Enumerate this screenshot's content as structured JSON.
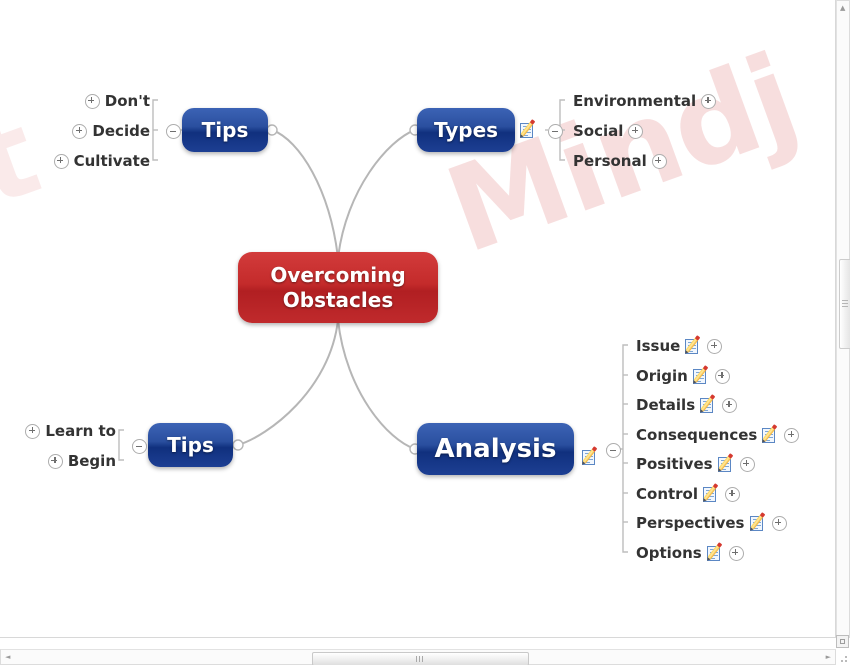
{
  "document": {
    "watermark_text": "Mindj",
    "watermark_text_left": "et"
  },
  "mindmap": {
    "root": {
      "label": "Overcoming Obstacles",
      "label_line1": "Overcoming",
      "label_line2": "Obstacles",
      "color": "#c42b2b"
    },
    "branches": [
      {
        "id": "tips-top",
        "label": "Tips",
        "color": "#1d3f93",
        "position": "top-left",
        "collapse_state": "minus",
        "has_note": false,
        "children": [
          {
            "label": "Don't",
            "toggle": "plus",
            "has_note": false
          },
          {
            "label": "Decide",
            "toggle": "plus",
            "has_note": false
          },
          {
            "label": "Cultivate",
            "toggle": "plus",
            "has_note": false
          }
        ]
      },
      {
        "id": "types",
        "label": "Types",
        "color": "#1d3f93",
        "position": "top-right",
        "collapse_state": "minus",
        "has_note": true,
        "children": [
          {
            "label": "Environmental",
            "toggle": "plus",
            "has_note": false
          },
          {
            "label": "Social",
            "toggle": "plus",
            "has_note": false
          },
          {
            "label": "Personal",
            "toggle": "plus",
            "has_note": false
          }
        ]
      },
      {
        "id": "tips-bottom",
        "label": "Tips",
        "color": "#1d3f93",
        "position": "bottom-left",
        "collapse_state": "minus",
        "has_note": false,
        "children": [
          {
            "label": "Learn to",
            "toggle": "plus",
            "has_note": false
          },
          {
            "label": "Begin",
            "toggle": "plus",
            "has_note": false
          }
        ]
      },
      {
        "id": "analysis",
        "label": "Analysis",
        "color": "#1d3f93",
        "position": "bottom-right",
        "collapse_state": "minus",
        "has_note": true,
        "children": [
          {
            "label": "Issue",
            "toggle": "plus",
            "has_note": true
          },
          {
            "label": "Origin",
            "toggle": "plus",
            "has_note": true
          },
          {
            "label": "Details",
            "toggle": "plus",
            "has_note": true
          },
          {
            "label": "Consequences",
            "toggle": "plus",
            "has_note": true
          },
          {
            "label": "Positives",
            "toggle": "plus",
            "has_note": true
          },
          {
            "label": "Control",
            "toggle": "plus",
            "has_note": true
          },
          {
            "label": "Perspectives",
            "toggle": "plus",
            "has_note": true
          },
          {
            "label": "Options",
            "toggle": "plus",
            "has_note": true
          }
        ]
      }
    ]
  },
  "scrollbars": {
    "vertical": {
      "up_arrow": "▲",
      "down_arrow": "▼"
    },
    "horizontal": {
      "left_arrow": "◄",
      "right_arrow": "►"
    }
  }
}
